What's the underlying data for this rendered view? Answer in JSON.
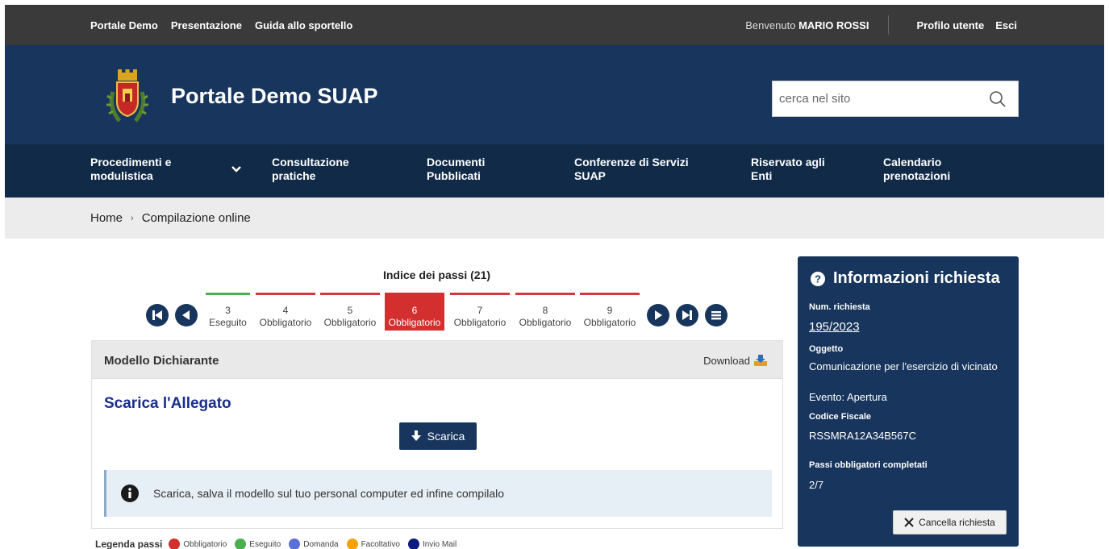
{
  "topbar": {
    "links": [
      "Portale Demo",
      "Presentazione",
      "Guida allo sportello"
    ],
    "welcome_prefix": "Benvenuto",
    "user_name": "MARIO ROSSI",
    "profile_link": "Profilo utente",
    "logout_link": "Esci"
  },
  "header": {
    "site_title": "Portale Demo SUAP",
    "search_placeholder": "cerca nel sito",
    "logo_icon": "municipal-crest-icon",
    "search_icon": "search-icon"
  },
  "nav": {
    "items": [
      {
        "label": "Procedimenti e modulistica"
      },
      {
        "label": "Consultazione pratiche"
      },
      {
        "label": "Documenti Pubblicati"
      },
      {
        "label": "Conferenze di Servizi SUAP"
      },
      {
        "label": "Riservato agli Enti"
      },
      {
        "label": "Calendario prenotazioni"
      }
    ]
  },
  "breadcrumb": {
    "home": "Home",
    "separator": "›",
    "current": "Compilazione online"
  },
  "steps": {
    "title": "Indice dei passi (21)",
    "items": [
      {
        "num": "3",
        "status": "Eseguito",
        "color": "#4caf50"
      },
      {
        "num": "4",
        "status": "Obbligatorio",
        "color": "#d9363e"
      },
      {
        "num": "5",
        "status": "Obbligatorio",
        "color": "#d9363e"
      },
      {
        "num": "6",
        "status": "Obbligatorio",
        "color": "#d32f2f",
        "active": true
      },
      {
        "num": "7",
        "status": "Obbligatorio",
        "color": "#d9363e"
      },
      {
        "num": "8",
        "status": "Obbligatorio",
        "color": "#d9363e"
      },
      {
        "num": "9",
        "status": "Obbligatorio",
        "color": "#d9363e"
      }
    ]
  },
  "panel": {
    "title": "Modello Dichiarante",
    "download_label": "Download",
    "section_title": "Scarica l'Allegato",
    "button_label": "Scarica",
    "info_text": "Scarica, salva il modello sul tuo personal computer ed infine compilalo"
  },
  "legend": {
    "title": "Legenda passi",
    "items": [
      {
        "label": "Obbligatorio",
        "color": "#d32f2f"
      },
      {
        "label": "Eseguito",
        "color": "#4caf50"
      },
      {
        "label": "Domanda",
        "color": "#5a6fd8"
      },
      {
        "label": "Facoltativo",
        "color": "#f5a300"
      },
      {
        "label": "Invio Mail",
        "color": "#0d1a80"
      }
    ]
  },
  "sidebar": {
    "title": "Informazioni richiesta",
    "num_label": "Num. richiesta",
    "num_value": "195/2023",
    "oggetto_label": "Oggetto",
    "oggetto_value": "Comunicazione per l'esercizio di vicinato",
    "evento_value": "Evento: Apertura",
    "cf_label": "Codice Fiscale",
    "cf_value": "RSSMRA12A34B567C",
    "passi_label": "Passi obbligatori completati",
    "passi_value": "2/7",
    "cancel_label": "Cancella richiesta"
  },
  "colors": {
    "topbar_bg": "#3a3a3a",
    "header_bg": "#18365d",
    "nav_bg": "#102a48",
    "accent_red": "#d32f2f",
    "accent_green": "#4caf50",
    "title_blue": "#1a2e8c"
  }
}
